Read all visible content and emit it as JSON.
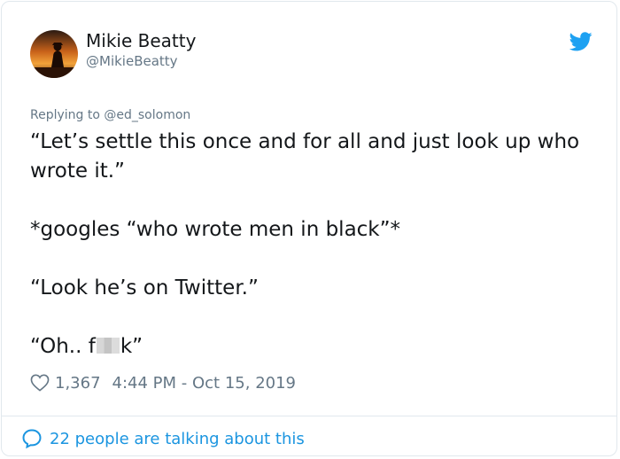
{
  "author": {
    "name": "Mikie Beatty",
    "handle": "@MikieBeatty",
    "avatar_icon": "silhouette-sunset-avatar"
  },
  "reply_context": "Replying to @ed_solomon",
  "tweet": {
    "para1": "“Let’s settle this once and for all and just look up who wrote it.”",
    "para2": "*googles “who wrote men in black”*",
    "para3": "“Look he’s on Twitter.”",
    "para4_before": "“Oh.. f",
    "para4_after": "k”"
  },
  "meta": {
    "likes": "1,367",
    "timestamp": "4:44 PM - Oct 15, 2019"
  },
  "footer": {
    "talking": "22 people are talking about this"
  },
  "colors": {
    "accent": "#1b95e0",
    "muted": "#657786",
    "text": "#14171a"
  }
}
